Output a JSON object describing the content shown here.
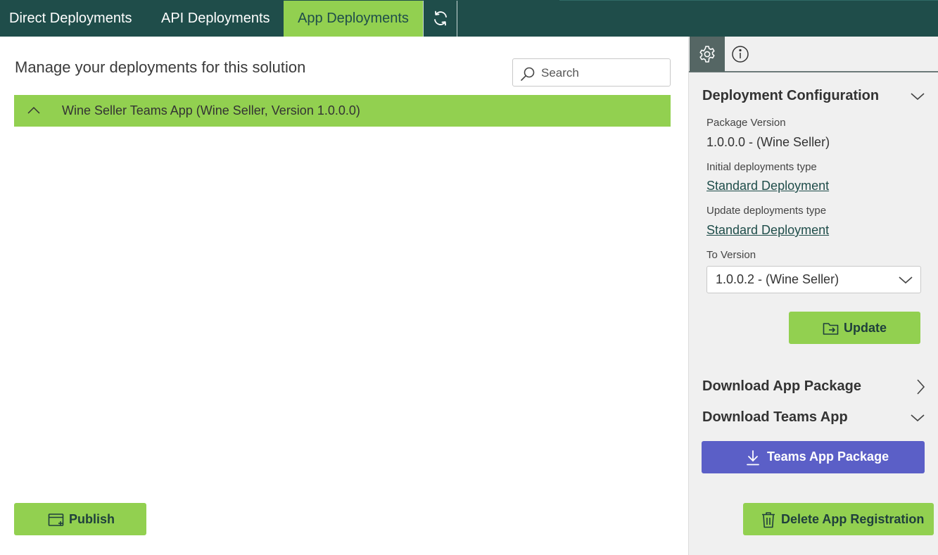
{
  "tabs": {
    "direct": "Direct Deployments",
    "api": "API Deployments",
    "app": "App Deployments",
    "refresh_icon": "refresh-icon"
  },
  "main": {
    "title": "Manage your deployments for this solution",
    "search_placeholder": "Search",
    "app_row_label": "Wine Seller Teams App (Wine Seller, Version 1.0.0.0)",
    "publish_label": "Publish"
  },
  "side": {
    "tab_icons": [
      "gear-icon",
      "info-icon"
    ],
    "deployment_configuration": {
      "heading": "Deployment Configuration",
      "package_version_label": "Package Version",
      "package_version_value": "1.0.0.0 - (Wine Seller)",
      "initial_type_label": "Initial deployments type",
      "initial_type_value": "Standard Deployment",
      "update_type_label": "Update deployments type",
      "update_type_value": "Standard Deployment",
      "to_version_label": "To Version",
      "to_version_value": "1.0.0.2 - (Wine Seller)",
      "update_label": "Update"
    },
    "download_app_package": "Download App Package",
    "download_teams_app": "Download Teams App",
    "teams_app_package_label": "Teams App Package",
    "delete_label": "Delete App Registration"
  },
  "colors": {
    "header_bg": "#1f4d4a",
    "accent_green": "#92d050",
    "teams_purple": "#5b5fc7",
    "side_bg": "#f0f0f0"
  }
}
